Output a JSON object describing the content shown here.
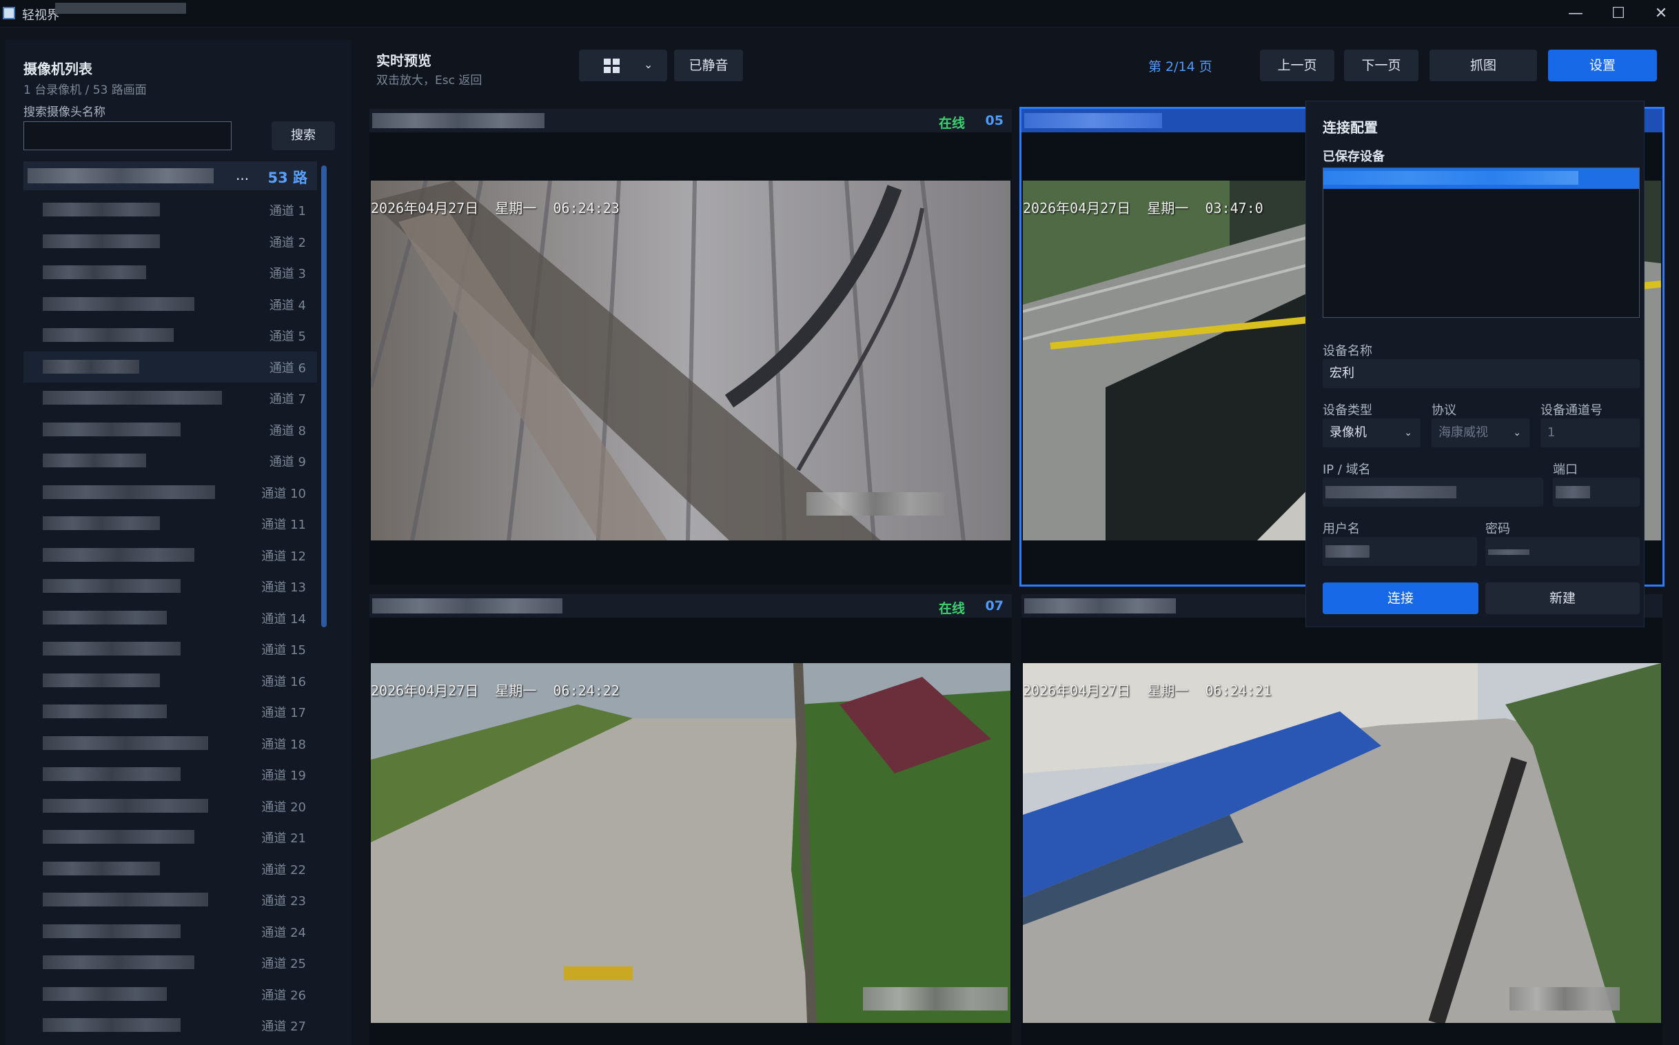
{
  "window": {
    "title": "轻视界",
    "minimize": "—",
    "maximize": "☐",
    "close": "✕"
  },
  "sidebar": {
    "title": "摄像机列表",
    "subtitle": "1 台录像机 / 53 路画面",
    "search_label": "搜索摄像头名称",
    "search_value": "",
    "search_button": "搜索",
    "nvr": {
      "ellipsis": "...",
      "count": "53 路"
    },
    "channels": [
      "通道 1",
      "通道 2",
      "通道 3",
      "通道 4",
      "通道 5",
      "通道 6",
      "通道 7",
      "通道 8",
      "通道 9",
      "通道 10",
      "通道 11",
      "通道 12",
      "通道 13",
      "通道 14",
      "通道 15",
      "通道 16",
      "通道 17",
      "通道 18",
      "通道 19",
      "通道 20",
      "通道 21",
      "通道 22",
      "通道 23",
      "通道 24",
      "通道 25",
      "通道 26",
      "通道 27"
    ],
    "selected_channel": "通道 6"
  },
  "toolbar": {
    "title": "实时预览",
    "subtitle": "双击放大，Esc 返回",
    "layout_icon": "grid-2x2-icon",
    "dropdown_icon": "chevron-down-icon",
    "mute_label": "已静音",
    "page_indicator": "第 2/14 页",
    "prev_label": "上一页",
    "next_label": "下一页",
    "capture_label": "抓图",
    "settings_label": "设置"
  },
  "tiles": [
    {
      "status": "在线",
      "number": "05",
      "osd": "2026年04月27日  星期一  06:24:23"
    },
    {
      "status": "",
      "number": "",
      "osd": "2026年04月27日  星期一  03:47:0"
    },
    {
      "status": "在线",
      "number": "07",
      "osd": "2026年04月27日  星期一  06:24:22"
    },
    {
      "status": "",
      "number": "",
      "osd": "2026年04月27日  星期一  06:24:21"
    }
  ],
  "connection": {
    "title": "连接配置",
    "saved_label": "已保存设备",
    "name_label": "设备名称",
    "name_value": "宏利",
    "type_label": "设备类型",
    "type_value": "录像机",
    "protocol_label": "协议",
    "protocol_value": "海康威视",
    "channel_label": "设备通道号",
    "channel_value": "1",
    "ip_label": "IP / 域名",
    "port_label": "端口",
    "user_label": "用户名",
    "password_label": "密码",
    "connect_button": "连接",
    "new_button": "新建"
  },
  "colors": {
    "accent": "#1769e8",
    "online": "#3bd16f",
    "background": "#0f141d"
  }
}
